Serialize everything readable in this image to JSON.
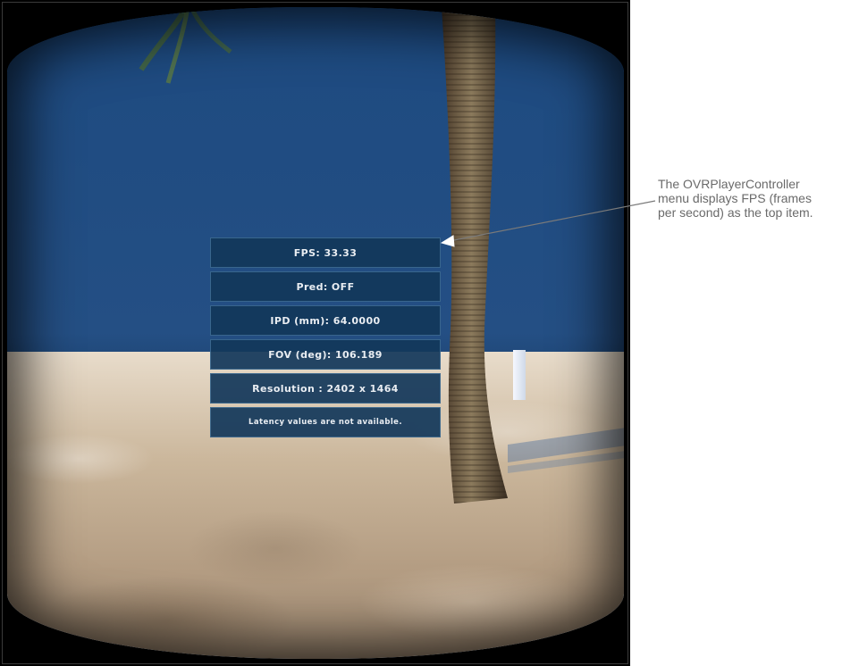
{
  "menu": {
    "items": [
      {
        "label": "FPS: 33.33"
      },
      {
        "label": "Pred: OFF"
      },
      {
        "label": "IPD (mm): 64.0000"
      },
      {
        "label": "FOV (deg): 106.189"
      },
      {
        "label": "Resolution : 2402 x 1464"
      },
      {
        "label": "Latency values are not available."
      }
    ]
  },
  "annotation": {
    "text": "The OVRPlayerController\nmenu displays FPS (frames\nper second) as the top item."
  },
  "colors": {
    "sky": "#244f84",
    "menu_panel": "#12375a",
    "menu_text": "#e9edf2",
    "annotation_text": "#6a6a6a"
  }
}
